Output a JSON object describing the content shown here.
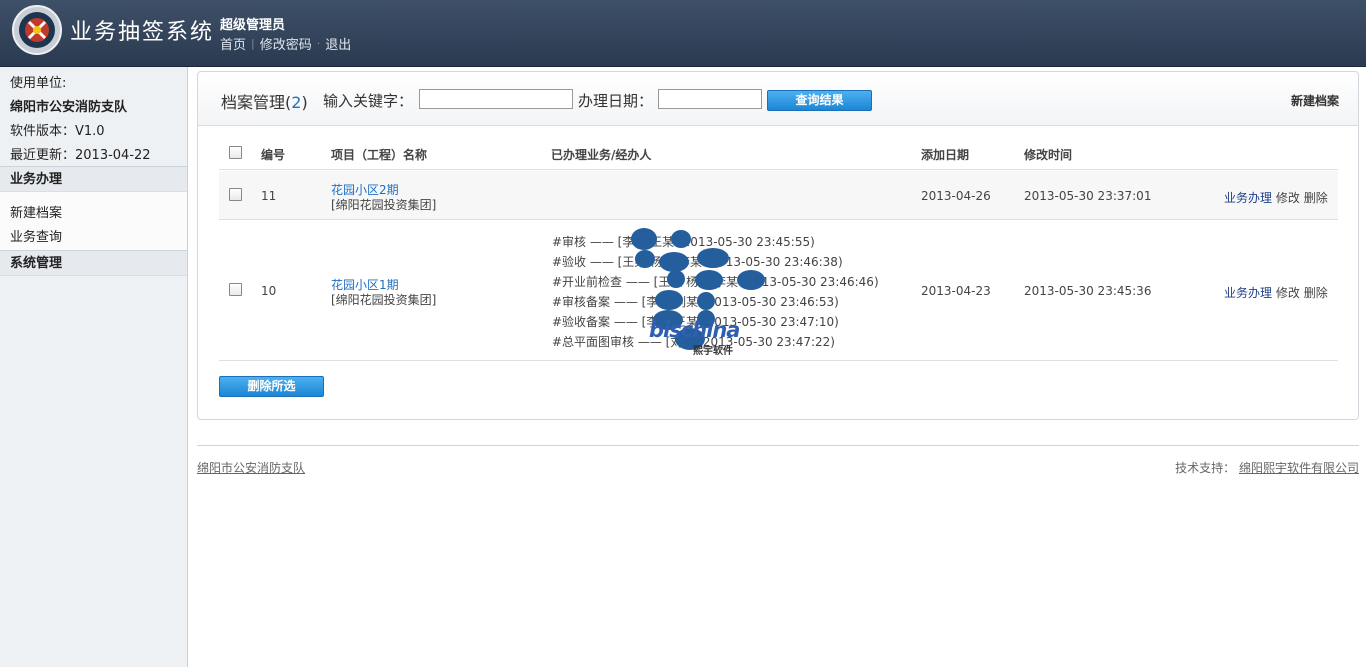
{
  "header": {
    "app_title": "业务抽签系统",
    "user_role": "超级管理员",
    "links": [
      "首页",
      "修改密码",
      "退出"
    ],
    "colors": {
      "bar": "#34465e",
      "text": "#ffffff"
    }
  },
  "sidebar": {
    "unit_label": "使用单位:",
    "unit_name": "绵阳市公安消防支队",
    "version": "软件版本：V1.0",
    "last_update": "最近更新：2013-04-22",
    "sections": [
      {
        "title": "业务办理",
        "items": [
          "新建档案",
          "业务查询"
        ]
      },
      {
        "title": "系统管理",
        "items": []
      }
    ]
  },
  "toolbar": {
    "title": "档案管理",
    "count": "2",
    "keyword_label": "输入关键字：",
    "keyword_value": "",
    "date_label": "办理日期：",
    "date_value": "",
    "search_button": "查询结果",
    "new_record": "新建档案"
  },
  "table": {
    "headers": [
      "编号",
      "项目（工程）名称",
      "已办理业务/经办人",
      "添加日期",
      "修改时间"
    ],
    "rows": [
      {
        "id": "11",
        "project_name": "花园小区2期",
        "project_company": "[绵阳花园投资集团]",
        "logs": [],
        "added": "2013-04-26",
        "modified": "2013-05-30 23:37:01",
        "actions": [
          "业务办理",
          "修改",
          "删除"
        ]
      },
      {
        "id": "10",
        "project_name": "花园小区1期",
        "project_company": "[绵阳花园投资集团]",
        "logs": [
          "#审核 —— [李某  王某  (2013-05-30 23:45:55)",
          "#验收 —— [王某 杨某  李某  (2013-05-30 23:46:38)",
          "#开业前检查 —— [王某 杨某  李某  (2013-05-30 23:46:46)",
          "#审核备案 —— [李某  刘某  (2013-05-30 23:46:53)",
          "#验收备案 —— [李某  王某  (2013-05-30 23:47:10)",
          "#总平面图审核 —— [刘某  (2013-05-30 23:47:22)"
        ],
        "added": "2013-04-23",
        "modified": "2013-05-30 23:45:36",
        "actions": [
          "业务办理",
          "修改",
          "删除"
        ]
      }
    ],
    "delete_selected": "删除所选"
  },
  "watermark": {
    "text": "bischina",
    "sub": "熙宇软件"
  },
  "footer": {
    "left": "绵阳市公安消防支队",
    "support_label": "技术支持：",
    "support_company": "绵阳熙宇软件有限公司"
  }
}
